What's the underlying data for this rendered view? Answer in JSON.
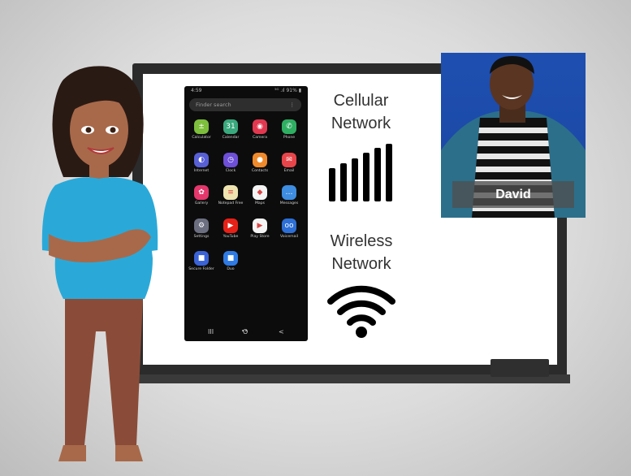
{
  "phone": {
    "time": "4:59",
    "status_right": "⁵ᴳ .ıl 91% ▮",
    "search_placeholder": "Finder search",
    "apps": [
      {
        "label": "Calculator",
        "icon": "calculator-icon",
        "color": "#7dbe3c",
        "glyph": "±"
      },
      {
        "label": "Calendar",
        "icon": "calendar-icon",
        "color": "#3aa97d",
        "glyph": "31"
      },
      {
        "label": "Camera",
        "icon": "camera-icon",
        "color": "#e2384f",
        "glyph": "◉"
      },
      {
        "label": "Phone",
        "icon": "phone-icon",
        "color": "#2fae62",
        "glyph": "✆"
      },
      {
        "label": "Internet",
        "icon": "internet-icon",
        "color": "#5860d6",
        "glyph": "◐"
      },
      {
        "label": "Clock",
        "icon": "clock-icon",
        "color": "#6d4fd8",
        "glyph": "◷"
      },
      {
        "label": "Contacts",
        "icon": "contacts-icon",
        "color": "#f08a2b",
        "glyph": "●"
      },
      {
        "label": "Email",
        "icon": "email-icon",
        "color": "#e8454a",
        "glyph": "✉"
      },
      {
        "label": "Gallery",
        "icon": "gallery-icon",
        "color": "#e4376c",
        "glyph": "✿"
      },
      {
        "label": "Notepad Free",
        "icon": "notepad-icon",
        "color": "#efe4b0",
        "glyph": "≡"
      },
      {
        "label": "Maps",
        "icon": "maps-icon",
        "color": "#f4f4f4",
        "glyph": "◆"
      },
      {
        "label": "Messages",
        "icon": "messages-icon",
        "color": "#3e8de0",
        "glyph": "…"
      },
      {
        "label": "Settings",
        "icon": "settings-icon",
        "color": "#6b6f80",
        "glyph": "⚙"
      },
      {
        "label": "YouTube",
        "icon": "youtube-icon",
        "color": "#e62117",
        "glyph": "▶"
      },
      {
        "label": "Play Store",
        "icon": "play-store-icon",
        "color": "#f4f4f4",
        "glyph": "▶"
      },
      {
        "label": "Voicemail",
        "icon": "voicemail-icon",
        "color": "#2d6fd6",
        "glyph": "oo"
      },
      {
        "label": "Secure Folder",
        "icon": "secure-folder-icon",
        "color": "#3b63d8",
        "glyph": "■"
      },
      {
        "label": "Duo",
        "icon": "duo-icon",
        "color": "#2f7be6",
        "glyph": "■"
      }
    ],
    "nav": {
      "recent": "III",
      "home": "O",
      "back": "<"
    }
  },
  "labels": {
    "cellular_line1": "Cellular",
    "cellular_line2": "Network",
    "wireless_line1": "Wireless",
    "wireless_line2": "Network"
  },
  "person": {
    "name": "David"
  },
  "icons": {
    "cellular": "signal-bars-icon",
    "wireless": "wifi-icon"
  },
  "colors": {
    "photo_bg": "#1e4fb0",
    "narrator_shirt": "#2aa9d8"
  }
}
